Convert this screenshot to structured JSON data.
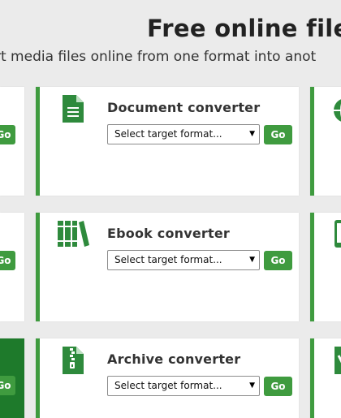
{
  "header": {
    "title": "Free online file",
    "subtitle": "rt media files online from one format into anot"
  },
  "theme": {
    "accent": "#3f9b3f",
    "accent_dark": "#1e7a2b"
  },
  "converters": [
    {
      "title": "Document converter",
      "select_placeholder": "Select target format...",
      "go_label": "Go",
      "icon": "document-icon"
    },
    {
      "title": "Ebook converter",
      "select_placeholder": "Select target format...",
      "go_label": "Go",
      "icon": "books-icon"
    },
    {
      "title": "Archive converter",
      "select_placeholder": "Select target format...",
      "go_label": "Go",
      "icon": "archive-zip-icon"
    }
  ],
  "left_partial": {
    "go_label": "Go"
  }
}
